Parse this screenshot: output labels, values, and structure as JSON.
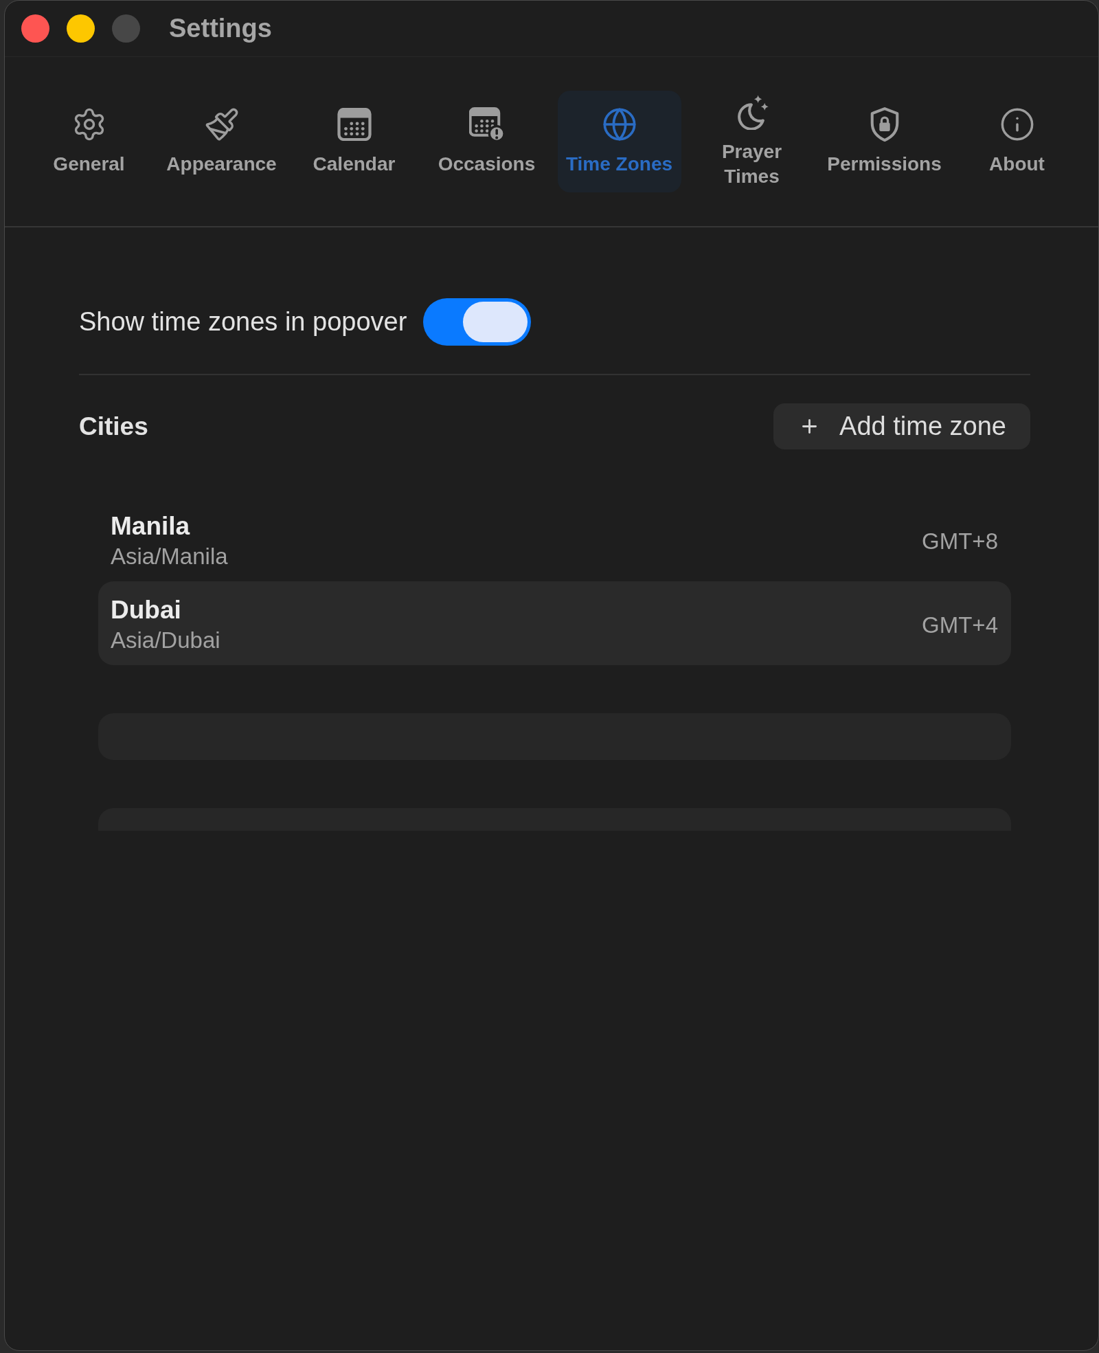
{
  "window": {
    "title": "Settings",
    "controls": [
      {
        "kind": "close",
        "disabled": false
      },
      {
        "kind": "minimize",
        "disabled": false
      },
      {
        "kind": "zoom",
        "disabled": true
      }
    ]
  },
  "tabs": [
    {
      "label": "General",
      "selected": false
    },
    {
      "label": "Appearance",
      "selected": false
    },
    {
      "label": "Calendar",
      "selected": false
    },
    {
      "label": "Occasions",
      "selected": false
    },
    {
      "label": "Time Zones",
      "selected": true
    },
    {
      "label": "Prayer Times",
      "selected": false
    },
    {
      "label": "Permissions",
      "selected": false
    },
    {
      "label": "About",
      "selected": false
    }
  ],
  "popover_toggle": {
    "label": "Show time zones in popover",
    "on": true
  },
  "cities": {
    "title": "Cities",
    "add_button": "Add time zone",
    "rows": [
      {
        "kind": "city",
        "name": "Manila",
        "zone": "Asia/Manila",
        "offset": "GMT+8",
        "selected": false
      },
      {
        "kind": "city",
        "name": "Dubai",
        "zone": "Asia/Dubai",
        "offset": "GMT+4",
        "selected": true
      },
      {
        "kind": "blank"
      },
      {
        "kind": "blank"
      }
    ]
  }
}
